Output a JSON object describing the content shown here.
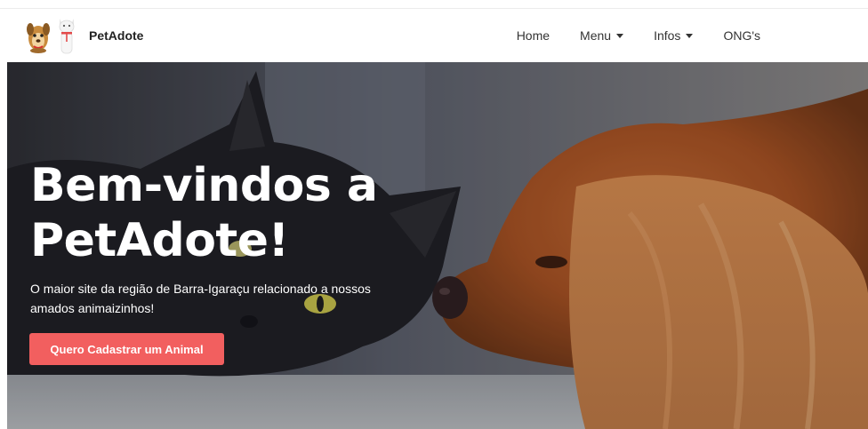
{
  "brand": {
    "name": "PetAdote",
    "logo_dog_icon": "dog-face-icon",
    "logo_cat_icon": "cat-figure-icon"
  },
  "nav": {
    "items": [
      {
        "label": "Home",
        "dropdown": false
      },
      {
        "label": "Menu",
        "dropdown": true
      },
      {
        "label": "Infos",
        "dropdown": true
      },
      {
        "label": "ONG's",
        "dropdown": false
      }
    ]
  },
  "hero": {
    "title": "Bem-vindos a PetAdote!",
    "subtitle": "O maior site da região de Barra-Igaraçu relacionado a nossos amados animaizinhos!",
    "cta_label": "Quero Cadastrar um Animal"
  },
  "colors": {
    "accent": "#f25f5f",
    "nav_text": "#333333",
    "hero_text": "#ffffff"
  }
}
